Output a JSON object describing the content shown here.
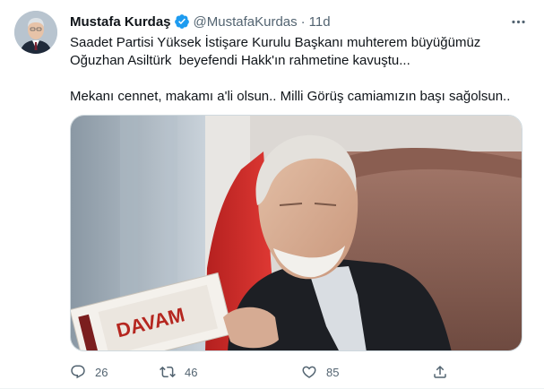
{
  "tweet": {
    "author_name": "Mustafa Kurdaş",
    "handle": "@MustafaKurdas",
    "separator": "·",
    "time": "11d",
    "text_line_1": "Saadet Partisi Yüksek İstişare Kurulu Başkanı muhterem büyüğümüz",
    "text_line_2": "Oğuzhan Asiltürk  beyefendi Hakk'ın rahmetine kavuştu...",
    "text_line_3": "Mekanı cennet, makamı a'li olsun.. Milli Görüş camiamızın başı sağolsun..",
    "media_book_title": "DAVAM"
  },
  "actions": {
    "replies": "26",
    "retweets": "46",
    "likes": "85"
  },
  "icons": {
    "verified": "verified-badge-icon",
    "more": "more-options-icon",
    "reply": "reply-icon",
    "retweet": "retweet-icon",
    "like": "heart-icon",
    "share": "share-icon"
  },
  "colors": {
    "verified_blue": "#1d9bf0",
    "secondary_text": "#536471",
    "primary_text": "#0f1419"
  }
}
